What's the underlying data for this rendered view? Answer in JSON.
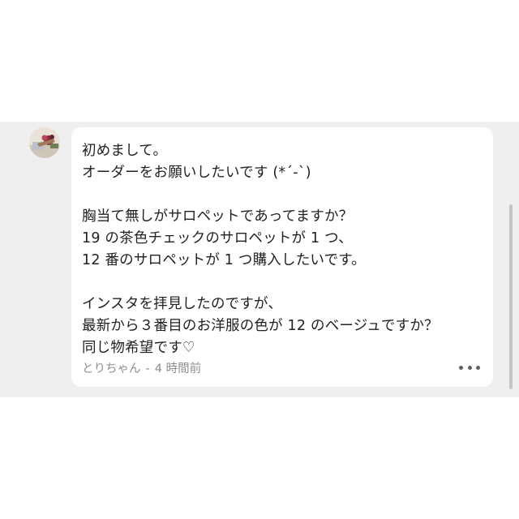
{
  "comment": {
    "lines": [
      "初めまして。",
      "オーダーをお願いしたいです (*´-`)",
      "",
      "胸当て無しがサロペットであってますか？",
      "19 の茶色チェックのサロペットが 1 つ、",
      "12 番のサロペットが 1 つ購入したいです。",
      "",
      "インスタを拝見したのですが、",
      "最新から３番目のお洋服の色が 12 のベージュですか？",
      "同じ物希望です♡"
    ],
    "author": "とりちゃん",
    "separator": "-",
    "time": "4 時間前"
  },
  "icons": {
    "avatar": "user-avatar-photo",
    "more": "more-horizontal-icon"
  },
  "colors": {
    "background": "#efefef",
    "bubble": "#ffffff",
    "text": "#222222",
    "meta": "#8e8e8e"
  }
}
